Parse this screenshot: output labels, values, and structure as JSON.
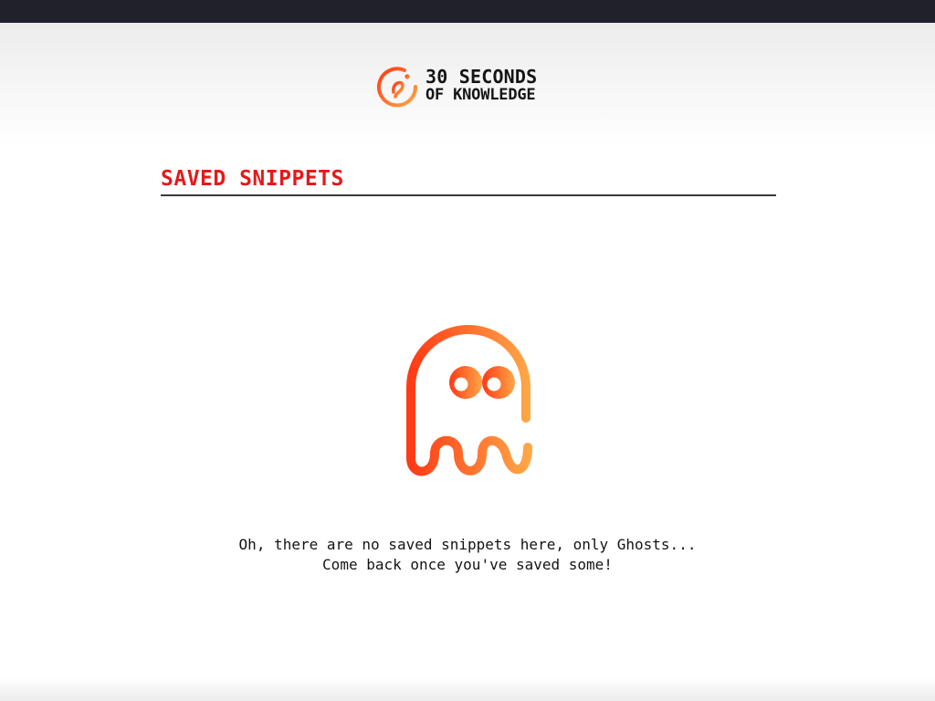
{
  "brand": {
    "line1": "30 SECONDS",
    "line2": "OF KNOWLEDGE",
    "logo_icon": "bulb-icon",
    "accent_start": "#ff3b16",
    "accent_end": "#ffa646"
  },
  "page": {
    "title": "SAVED SNIPPETS"
  },
  "empty_state": {
    "illustration": "ghost-icon",
    "line1": "Oh, there are no saved snippets here, only Ghosts...",
    "line2": "Come back once you've saved some!"
  },
  "colors": {
    "title": "#e5191a",
    "top_bar": "#20212b",
    "text": "#141414"
  }
}
